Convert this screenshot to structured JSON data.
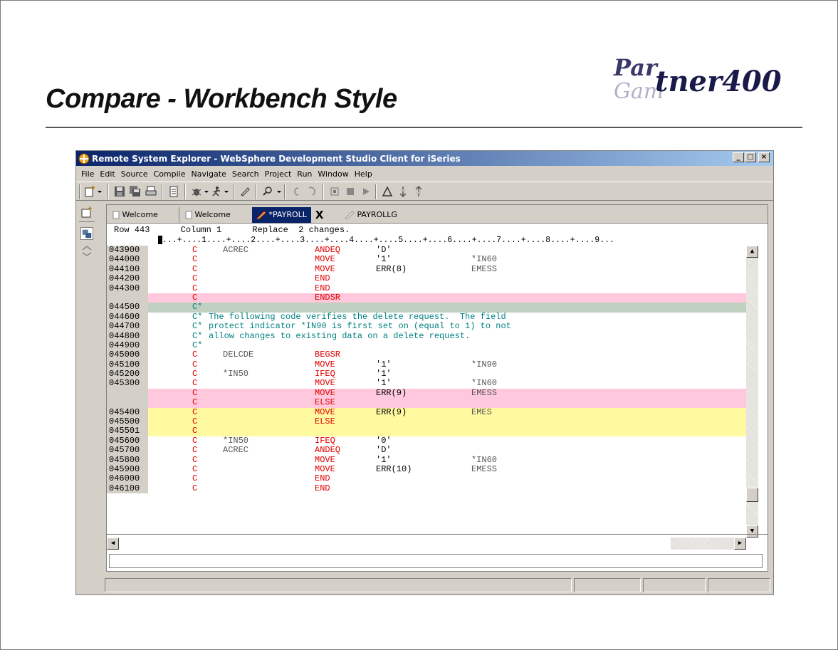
{
  "slide": {
    "title": "Compare - Workbench Style",
    "logo_text": "Partner400"
  },
  "window": {
    "title": "Remote System Explorer - WebSphere Development Studio Client for iSeries",
    "menu": [
      "File",
      "Edit",
      "Source",
      "Compile",
      "Navigate",
      "Search",
      "Project",
      "Run",
      "Window",
      "Help"
    ]
  },
  "tabs": [
    {
      "label": "Welcome"
    },
    {
      "label": "Welcome"
    },
    {
      "label": "*PAYROLL",
      "close": "X"
    },
    {
      "label": "PAYROLLG"
    }
  ],
  "editor": {
    "status_text": "Row 443      Column 1      Replace  2 changes.",
    "ruler": "...+....1....+....2....+....3....+....4....+....5....+....6....+....7....+....8....+....9..."
  },
  "code_lines": [
    {
      "seq": "043900",
      "spec": "C",
      "f1": "ACREC",
      "op": "ANDEQ",
      "f2": "'D'",
      "res": "",
      "cmt": "",
      "hl": ""
    },
    {
      "seq": "044000",
      "spec": "C",
      "f1": "",
      "op": "MOVE",
      "f2": "'1'",
      "res": "*IN60",
      "cmt": "",
      "hl": ""
    },
    {
      "seq": "044100",
      "spec": "C",
      "f1": "",
      "op": "MOVE",
      "f2": "ERR(8)",
      "res": "EMESS",
      "cmt": "",
      "hl": ""
    },
    {
      "seq": "044200",
      "spec": "C",
      "f1": "",
      "op": "END",
      "f2": "",
      "res": "",
      "cmt": "",
      "hl": ""
    },
    {
      "seq": "044300",
      "spec": "C",
      "f1": "",
      "op": "END",
      "f2": "",
      "res": "",
      "cmt": "",
      "hl": ""
    },
    {
      "seq": "",
      "spec": "C",
      "f1": "",
      "op": "ENDSR",
      "f2": "",
      "res": "",
      "cmt": "",
      "hl": "pink"
    },
    {
      "seq": "044500",
      "spec": "C*",
      "f1": "",
      "op": "",
      "f2": "",
      "res": "",
      "cmt": "",
      "hl": "gray"
    },
    {
      "seq": "044600",
      "spec": "C*",
      "f1": "",
      "op": "",
      "f2": "",
      "res": "",
      "cmt": "The following code verifies the delete request.  The field",
      "hl": ""
    },
    {
      "seq": "044700",
      "spec": "C*",
      "f1": "",
      "op": "",
      "f2": "",
      "res": "",
      "cmt": "protect indicator *IN90 is first set on (equal to 1) to not",
      "hl": ""
    },
    {
      "seq": "044800",
      "spec": "C*",
      "f1": "",
      "op": "",
      "f2": "",
      "res": "",
      "cmt": "allow changes to existing data on a delete request.",
      "hl": ""
    },
    {
      "seq": "044900",
      "spec": "C*",
      "f1": "",
      "op": "",
      "f2": "",
      "res": "",
      "cmt": "",
      "hl": ""
    },
    {
      "seq": "045000",
      "spec": "C",
      "f1": "DELCDE",
      "op": "BEGSR",
      "f2": "",
      "res": "",
      "cmt": "",
      "hl": ""
    },
    {
      "seq": "045100",
      "spec": "C",
      "f1": "",
      "op": "MOVE",
      "f2": "'1'",
      "res": "*IN90",
      "cmt": "",
      "hl": ""
    },
    {
      "seq": "045200",
      "spec": "C",
      "f1": "*IN50",
      "op": "IFEQ",
      "f2": "'1'",
      "res": "",
      "cmt": "",
      "hl": ""
    },
    {
      "seq": "045300",
      "spec": "C",
      "f1": "",
      "op": "MOVE",
      "f2": "'1'",
      "res": "*IN60",
      "cmt": "",
      "hl": ""
    },
    {
      "seq": "",
      "spec": "C",
      "f1": "",
      "op": "MOVE",
      "f2": "ERR(9)",
      "res": "EMESS",
      "cmt": "",
      "hl": "pink"
    },
    {
      "seq": "",
      "spec": "C",
      "f1": "",
      "op": "ELSE",
      "f2": "",
      "res": "",
      "cmt": "",
      "hl": "pink"
    },
    {
      "seq": "045400",
      "spec": "C",
      "f1": "",
      "op": "MOVE",
      "f2": "ERR(9)",
      "res": "EMES",
      "cmt": "",
      "hl": "yellow"
    },
    {
      "seq": "045500",
      "spec": "C",
      "f1": "",
      "op": "ELSE",
      "f2": "",
      "res": "",
      "cmt": "",
      "hl": "yellow"
    },
    {
      "seq": "045501",
      "spec": "C",
      "f1": "",
      "op": "",
      "f2": "",
      "res": "",
      "cmt": "",
      "hl": "yellow"
    },
    {
      "seq": "045600",
      "spec": "C",
      "f1": "*IN50",
      "op": "IFEQ",
      "f2": "'0'",
      "res": "",
      "cmt": "",
      "hl": ""
    },
    {
      "seq": "045700",
      "spec": "C",
      "f1": "ACREC",
      "op": "ANDEQ",
      "f2": "'D'",
      "res": "",
      "cmt": "",
      "hl": ""
    },
    {
      "seq": "045800",
      "spec": "C",
      "f1": "",
      "op": "MOVE",
      "f2": "'1'",
      "res": "*IN60",
      "cmt": "",
      "hl": ""
    },
    {
      "seq": "045900",
      "spec": "C",
      "f1": "",
      "op": "MOVE",
      "f2": "ERR(10)",
      "res": "EMESS",
      "cmt": "",
      "hl": ""
    },
    {
      "seq": "046000",
      "spec": "C",
      "f1": "",
      "op": "END",
      "f2": "",
      "res": "",
      "cmt": "",
      "hl": ""
    },
    {
      "seq": "046100",
      "spec": "C",
      "f1": "",
      "op": "END",
      "f2": "",
      "res": "",
      "cmt": "",
      "hl": ""
    }
  ],
  "colors": {
    "added_line": "#ffc8dc",
    "changed_line": "#fffaa0",
    "separator_line": "#c0d0c0",
    "keyword": "#e00000",
    "comment": "#008080"
  }
}
